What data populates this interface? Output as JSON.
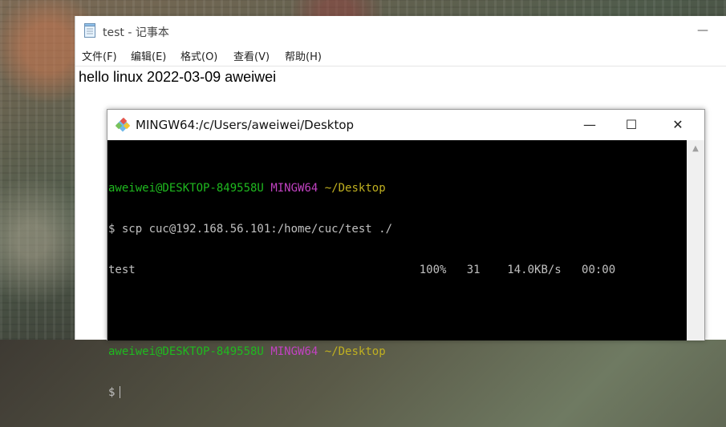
{
  "notepad": {
    "title": "test - 记事本",
    "minimize_glyph": "—",
    "menu": [
      "文件(F)",
      "编辑(E)",
      "格式(O)",
      "查看(V)",
      "帮助(H)"
    ],
    "content": "hello linux 2022-03-09 aweiwei"
  },
  "terminal": {
    "title": "MINGW64:/c/Users/aweiwei/Desktop",
    "buttons": {
      "minimize": "—",
      "maximize": "☐",
      "close": "✕"
    },
    "prompt1": {
      "userhost": "aweiwei@DESKTOP-849558U",
      "env": "MINGW64",
      "path": "~/Desktop"
    },
    "command": "$ scp cuc@192.168.56.101:/home/cuc/test ./",
    "progress_line": "test                                          100%   31    14.0KB/s   00:00",
    "prompt2": {
      "userhost": "aweiwei@DESKTOP-849558U",
      "env": "MINGW64",
      "path": "~/Desktop"
    },
    "current_prompt": "$"
  },
  "colors": {
    "prompt_user": "#1fb91f",
    "prompt_env": "#c242c2",
    "prompt_path": "#c0b020",
    "terminal_bg": "#000000"
  }
}
